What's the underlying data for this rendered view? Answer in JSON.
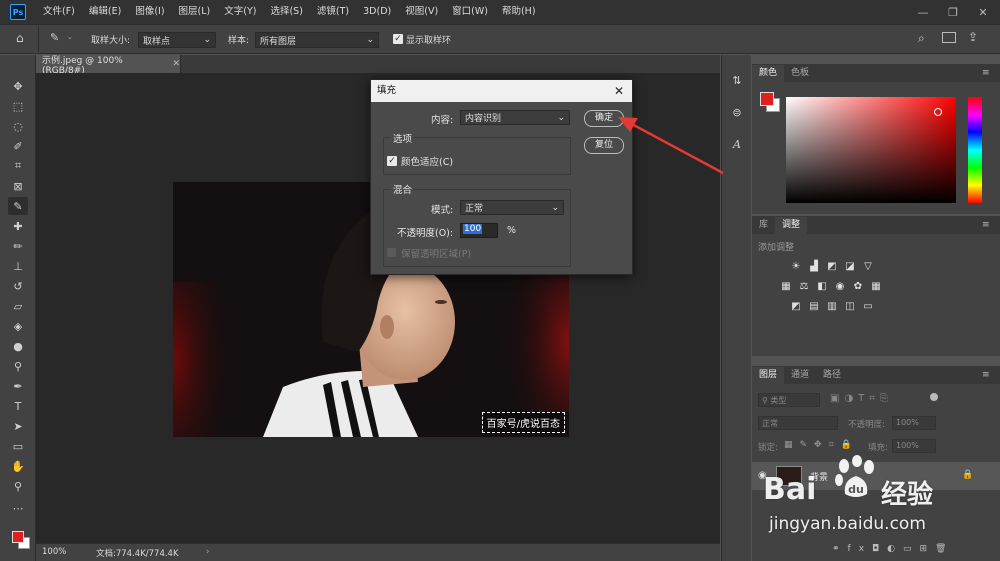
{
  "app": {
    "logo": "Ps",
    "menu": [
      "文件(F)",
      "编辑(E)",
      "图像(I)",
      "图层(L)",
      "文字(Y)",
      "选择(S)",
      "滤镜(T)",
      "3D(D)",
      "视图(V)",
      "窗口(W)",
      "帮助(H)"
    ]
  },
  "options": {
    "sample_size_label": "取样大小:",
    "sample_size_value": "取样点",
    "sample_label": "样本:",
    "sample_value": "所有图层",
    "show_ring_label": "显示取样环"
  },
  "document": {
    "tab_title": "示例.jpeg @ 100%(RGB/8#)",
    "watermark_text": "百家号/虎说百态",
    "zoom": "100%",
    "doc_info": "文档:774.4K/774.4K"
  },
  "panels": {
    "color_tabs": [
      "颜色",
      "色板"
    ],
    "adjust_tabs": [
      "库",
      "调整"
    ],
    "add_adjustment": "添加调整",
    "layer_tabs": [
      "图层",
      "通道",
      "路径"
    ],
    "kind_filter": "类型",
    "blend_mode": "正常",
    "opacity_label": "不透明度:",
    "opacity_value": "100%",
    "lock_label": "锁定:",
    "fill_label": "填充:",
    "fill_value": "100%",
    "layer_name": "背景"
  },
  "dialog": {
    "title": "填充",
    "content_label": "内容:",
    "content_value": "内容识别",
    "options_group": "选项",
    "color_adapt_label": "颜色适应(C)",
    "blend_group": "混合",
    "mode_label": "模式:",
    "mode_value": "正常",
    "opacity_label": "不透明度(O):",
    "opacity_value": "100",
    "percent": "%",
    "preserve_label": "保留透明区域(P)",
    "ok_label": "确定",
    "reset_label": "复位"
  },
  "baidu_watermark": {
    "brand_left": "Bai",
    "brand_right": "经验",
    "url": "jingyan.baidu.com"
  },
  "colors": {
    "foreground": "#e02020",
    "background": "#ffffff",
    "arrow": "#e53935"
  }
}
